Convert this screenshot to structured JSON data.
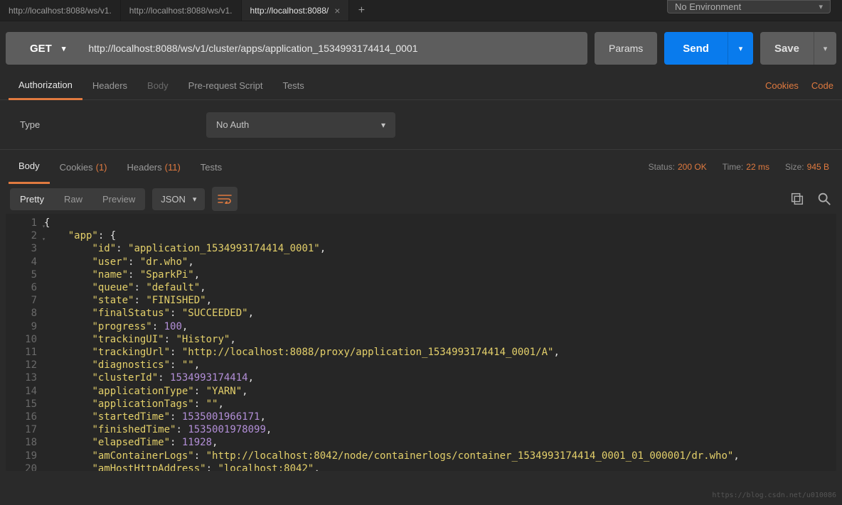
{
  "env": {
    "label": "No Environment"
  },
  "tabs": [
    {
      "label": "http://localhost:8088/ws/v1."
    },
    {
      "label": "http://localhost:8088/ws/v1."
    },
    {
      "label": "http://localhost:8088/"
    }
  ],
  "request": {
    "method": "GET",
    "url": "http://localhost:8088/ws/v1/cluster/apps/application_1534993174414_0001",
    "params_label": "Params",
    "send_label": "Send",
    "save_label": "Save"
  },
  "req_tabs": {
    "authorization": "Authorization",
    "headers": "Headers",
    "body": "Body",
    "prerequest": "Pre-request Script",
    "tests": "Tests"
  },
  "req_links": {
    "cookies": "Cookies",
    "code": "Code"
  },
  "auth": {
    "label": "Type",
    "value": "No Auth"
  },
  "resp_tabs": {
    "body": "Body",
    "cookies": "Cookies",
    "cookies_count": "(1)",
    "headers": "Headers",
    "headers_count": "(11)",
    "tests": "Tests"
  },
  "resp_meta": {
    "status_label": "Status:",
    "status_value": "200 OK",
    "time_label": "Time:",
    "time_value": "22 ms",
    "size_label": "Size:",
    "size_value": "945 B"
  },
  "body_toolbar": {
    "pretty": "Pretty",
    "raw": "Raw",
    "preview": "Preview",
    "format": "JSON"
  },
  "json_body": {
    "app": {
      "id": "application_1534993174414_0001",
      "user": "dr.who",
      "name": "SparkPi",
      "queue": "default",
      "state": "FINISHED",
      "finalStatus": "SUCCEEDED",
      "progress": 100,
      "trackingUI": "History",
      "trackingUrl": "http://localhost:8088/proxy/application_1534993174414_0001/A",
      "diagnostics": "",
      "clusterId": 1534993174414,
      "applicationType": "YARN",
      "applicationTags": "",
      "startedTime": 1535001966171,
      "finishedTime": 1535001978099,
      "elapsedTime": 11928,
      "amContainerLogs": "http://localhost:8042/node/containerlogs/container_1534993174414_0001_01_000001/dr.who",
      "amHostHttpAddress": "localhost:8042"
    }
  },
  "watermark": "https://blog.csdn.net/u010086"
}
